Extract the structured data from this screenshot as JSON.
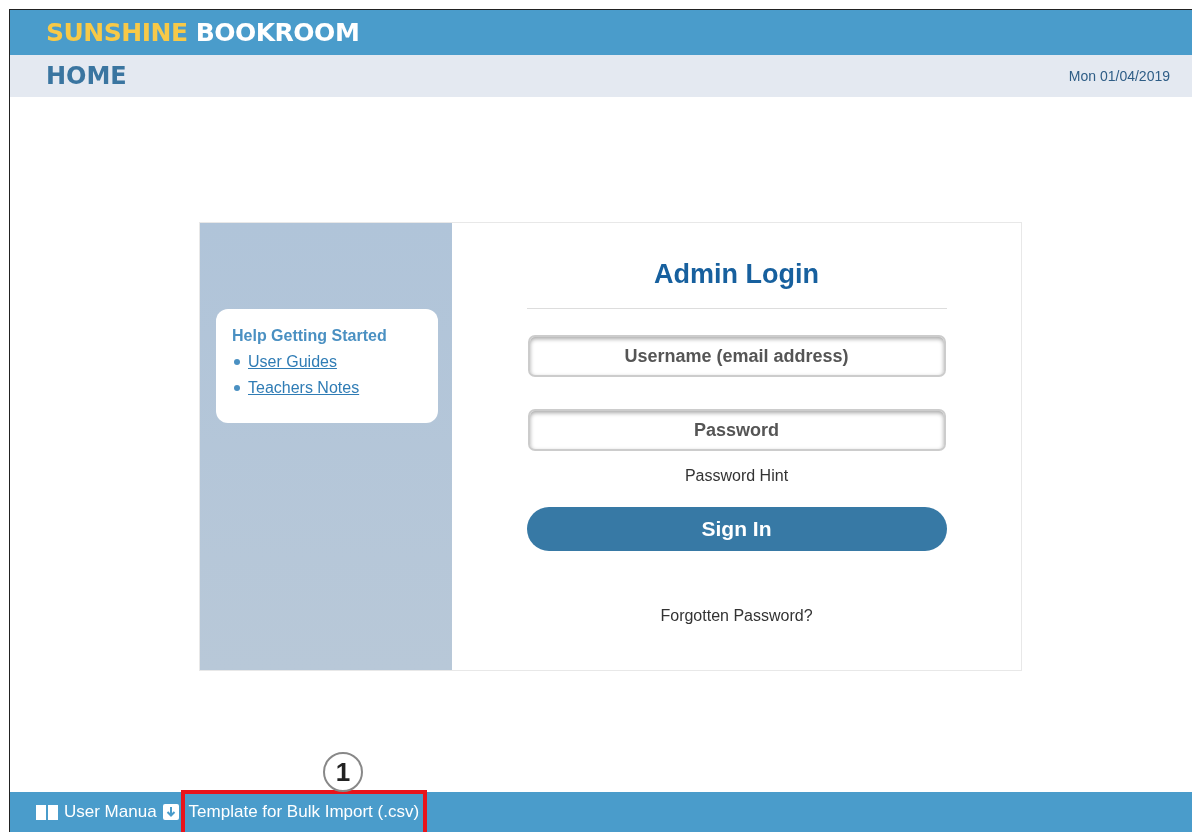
{
  "header": {
    "brand_first": "SUNSHINE",
    "brand_second": "BOOKROOM"
  },
  "subheader": {
    "title": "HOME",
    "date": "Mon 01/04/2019"
  },
  "help": {
    "title": "Help Getting Started",
    "links": [
      "User Guides",
      "Teachers Notes"
    ]
  },
  "login": {
    "title": "Admin Login",
    "username_placeholder": "Username (email address)",
    "password_placeholder": "Password",
    "hint": "Password Hint",
    "submit": "Sign In",
    "forgot": "Forgotten Password?"
  },
  "footer": {
    "items": [
      {
        "kind": "manual",
        "label": "User Manua"
      },
      {
        "kind": "download",
        "label": "Template for Bulk Import (.csv)"
      }
    ]
  },
  "callout": {
    "number": "1"
  }
}
